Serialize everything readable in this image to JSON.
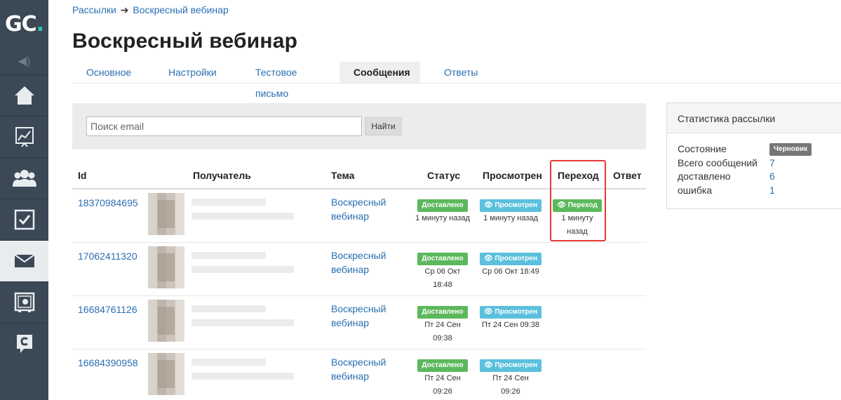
{
  "logo": "GC.",
  "sidebar": {
    "items": [
      {
        "icon": "home-icon"
      },
      {
        "icon": "chart-icon"
      },
      {
        "icon": "users-icon"
      },
      {
        "icon": "tasks-icon"
      },
      {
        "icon": "mail-icon",
        "active": true
      },
      {
        "icon": "safe-icon"
      },
      {
        "icon": "chat-icon"
      }
    ]
  },
  "breadcrumb": {
    "parent": "Рассылки",
    "separator": "➔",
    "current": "Воскресный вебинар"
  },
  "page_title": "Воскресный вебинар",
  "tabs": [
    {
      "label": "Основное"
    },
    {
      "label": "Настройки"
    },
    {
      "label": "Тестовое письмо"
    },
    {
      "label": "Сообщения",
      "active": true
    },
    {
      "label": "Ответы"
    }
  ],
  "search": {
    "placeholder": "Поиск email",
    "button": "Найти"
  },
  "table": {
    "headers": {
      "id": "Id",
      "recipient": "Получатель",
      "subject": "Тема",
      "status": "Статус",
      "viewed": "Просмотрен",
      "click": "Переход",
      "reply": "Ответ"
    },
    "rows": [
      {
        "id": "18370984695",
        "subject_line1": "Воскресный",
        "subject_line2": "вебинар",
        "status_badge": "Доставлено",
        "status_time1": "1 минуту назад",
        "status_time2": "",
        "viewed_badge": "Просмотрен",
        "viewed_time1": "1 минуту назад",
        "viewed_time2": "",
        "click_badge": "Переход",
        "click_time1": "1 минуту",
        "click_time2": "назад"
      },
      {
        "id": "17062411320",
        "subject_line1": "Воскресный",
        "subject_line2": "вебинар",
        "status_badge": "Доставлено",
        "status_time1": "Ср 06 Окт",
        "status_time2": "18:48",
        "viewed_badge": "Просмотрен",
        "viewed_time1": "Ср 06 Окт 18:49",
        "viewed_time2": ""
      },
      {
        "id": "16684761126",
        "subject_line1": "Воскресный",
        "subject_line2": "вебинар",
        "status_badge": "Доставлено",
        "status_time1": "Пт 24 Сен",
        "status_time2": "09:38",
        "viewed_badge": "Просмотрен",
        "viewed_time1": "Пт 24 Сен 09:38",
        "viewed_time2": ""
      },
      {
        "id": "16684390958",
        "subject_line1": "Воскресный",
        "subject_line2": "вебинар",
        "status_badge": "Доставлено",
        "status_time1": "Пт 24 Сен",
        "status_time2": "09:26",
        "viewed_badge": "Просмотрен",
        "viewed_time1": "Пт 24 Сен",
        "viewed_time2": "09:26"
      }
    ]
  },
  "stats": {
    "title": "Статистика рассылки",
    "rows": [
      {
        "label": "Состояние",
        "value": "Черновик"
      },
      {
        "label": "Всего сообщений",
        "value": "7"
      },
      {
        "label": "доставлено",
        "value": "6"
      },
      {
        "label": "ошибка",
        "value": "1"
      }
    ]
  },
  "colors": {
    "sidebar": "#3b4856",
    "link": "#2a6fb3",
    "delivered": "#5cb85c",
    "viewed": "#5bc0de",
    "highlight": "#e53935"
  }
}
